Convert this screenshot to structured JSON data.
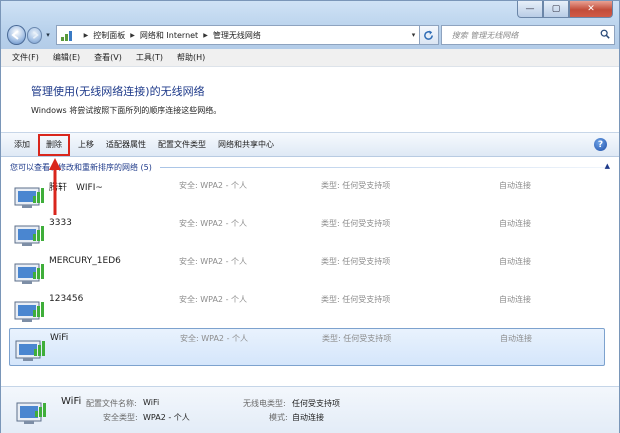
{
  "window": {
    "min_glyph": "—",
    "max_glyph": "▢",
    "close_glyph": "✕"
  },
  "navbar": {
    "breadcrumbs": [
      "控制面板",
      "网络和 Internet",
      "管理无线网络"
    ],
    "search_placeholder": "搜索 管理无线网络"
  },
  "menubar": {
    "items": [
      "文件(F)",
      "编辑(E)",
      "查看(V)",
      "工具(T)",
      "帮助(H)"
    ]
  },
  "header": {
    "title": "管理使用(无线网络连接)的无线网络",
    "description": "Windows 将尝试按照下面所列的顺序连接这些网络。"
  },
  "toolbar": {
    "commands": [
      "添加",
      "删除",
      "上移",
      "适配器属性",
      "配置文件类型",
      "网络和共享中心"
    ],
    "highlighted_index": 1
  },
  "group": {
    "label": "您可以查看、修改和重新排序的网络 (5)"
  },
  "networks": [
    {
      "name": "腾轩　WIFI~",
      "security": "安全: WPA2 - 个人",
      "type": "类型: 任何受支持项",
      "mode": "自动连接",
      "selected": false
    },
    {
      "name": "3333",
      "security": "安全: WPA2 - 个人",
      "type": "类型: 任何受支持项",
      "mode": "自动连接",
      "selected": false
    },
    {
      "name": "MERCURY_1ED6",
      "security": "安全: WPA2 - 个人",
      "type": "类型: 任何受支持项",
      "mode": "自动连接",
      "selected": false
    },
    {
      "name": "123456",
      "security": "安全: WPA2 - 个人",
      "type": "类型: 任何受支持项",
      "mode": "自动连接",
      "selected": false
    },
    {
      "name": "WiFi",
      "security": "安全: WPA2 - 个人",
      "type": "类型: 任何受支持项",
      "mode": "自动连接",
      "selected": true
    }
  ],
  "details": {
    "name": "WiFi",
    "profile_label": "配置文件名称:",
    "profile_value": "WiFi",
    "security_label": "安全类型:",
    "security_value": "WPA2 - 个人",
    "radio_label": "无线电类型:",
    "radio_value": "任何受支持项",
    "mode_label": "模式:",
    "mode_value": "自动连接"
  },
  "colors": {
    "link_blue": "#1e3a8a",
    "highlight_red": "#d9261c",
    "selection_border": "#7da2ce"
  }
}
